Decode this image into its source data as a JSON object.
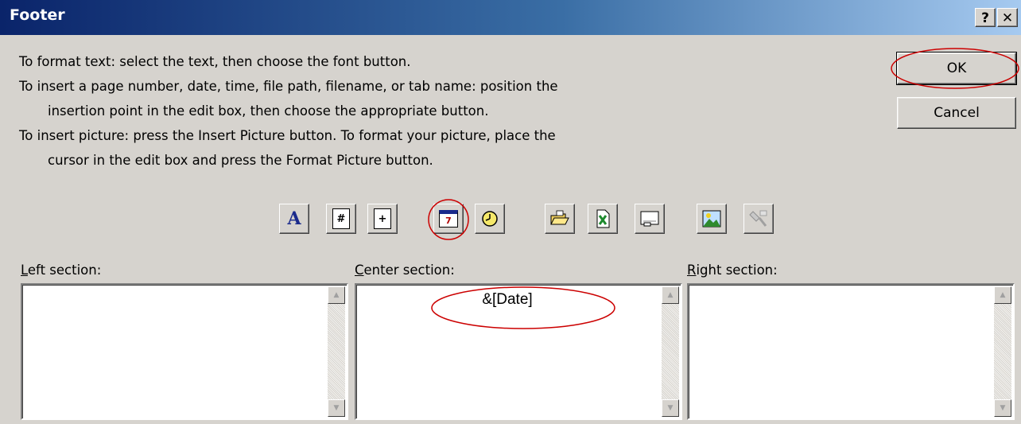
{
  "window": {
    "title": "Footer",
    "help_label": "?",
    "close_label": "✕"
  },
  "instructions": [
    "To format text:  select the text, then choose the font button.",
    "To insert a page number, date, time, file path, filename, or tab name:  position the",
    "insertion point in the edit box, then choose the appropriate button.",
    "To insert picture: press the Insert Picture button.  To format your picture, place the",
    "cursor in the edit box and press the Format Picture button."
  ],
  "buttons": {
    "ok_label": "OK",
    "cancel_label": "Cancel"
  },
  "toolbar": {
    "font_letter": "A",
    "page_number_glyph": "#",
    "total_pages_glyph": "+",
    "date_glyph": "7"
  },
  "sections": {
    "left_label_key": "L",
    "left_label_rest": "eft section:",
    "center_label_key": "C",
    "center_label_rest": "enter section:",
    "right_label_key": "R",
    "right_label_rest": "ight section:",
    "left_content": "",
    "center_content": "&[Date]",
    "right_content": ""
  },
  "icons": [
    "font-icon",
    "page-number-icon",
    "total-pages-icon",
    "date-icon",
    "time-icon",
    "file-path-icon",
    "filename-icon",
    "sheet-name-icon",
    "insert-picture-icon",
    "format-picture-icon"
  ],
  "colors": {
    "highlight_circle": "#cc0000",
    "title_bar_start": "#0a246a",
    "title_bar_end": "#a6caf0",
    "dialog_bg": "#d6d3ce"
  }
}
